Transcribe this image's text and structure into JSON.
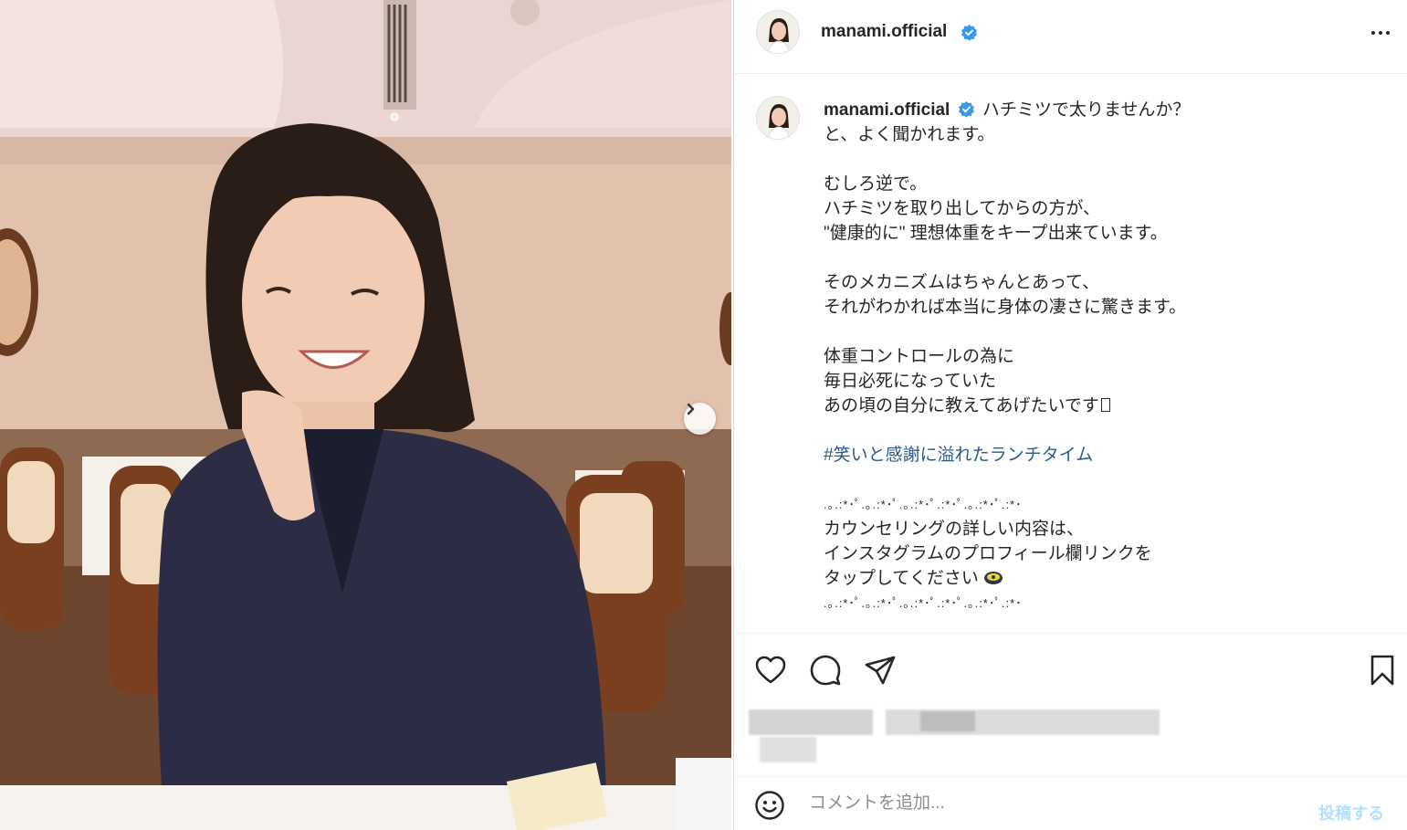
{
  "post": {
    "username": "manami.official",
    "verified": true,
    "more_icon": "more-horizontal-icon",
    "next_icon": "chevron-right-icon"
  },
  "caption": {
    "username": "manami.official",
    "lines": [
      "ハチミツで太りませんか？",
      "と、よく聞かれます。",
      "",
      "むしろ逆で。",
      "ハチミツを取り出してからの方が、",
      "\"健康的に\" 理想体重をキープ出来ています。",
      "",
      "そのメカニズムはちゃんとあって、",
      "それがわかれば本当に身体の凄さに驚きます。",
      "",
      "体重コントロールの為に",
      "毎日必死になっていた",
      "あの頃の自分に教えてあげたいです"
    ],
    "hashtag": "#笑いと感謝に溢れたランチタイム",
    "divider": ".｡.:*･ﾟ.｡.:*･ﾟ.｡.:*･ﾟ.:*･ﾟ.｡.:*･ﾟ.:*･",
    "cta_lines": [
      "カウンセリングの詳しい内容は、",
      "インスタグラムのプロフィール欄リンクを",
      "タップしてください"
    ],
    "divider_end": ".｡.:*･ﾟ.｡.:*･ﾟ.｡.:*･ﾟ.:*･ﾟ.｡.:*･ﾟ.:*･"
  },
  "actions": {
    "like_icon": "heart-icon",
    "comment_icon": "comment-icon",
    "share_icon": "send-icon",
    "save_icon": "bookmark-icon"
  },
  "comment_bar": {
    "emoji_icon": "smiley-icon",
    "placeholder": "コメントを追加...",
    "post_label": "投稿する"
  },
  "colors": {
    "link": "#2a5a89",
    "verified": "#3897f0",
    "post_button_disabled": "#b2dffc"
  }
}
